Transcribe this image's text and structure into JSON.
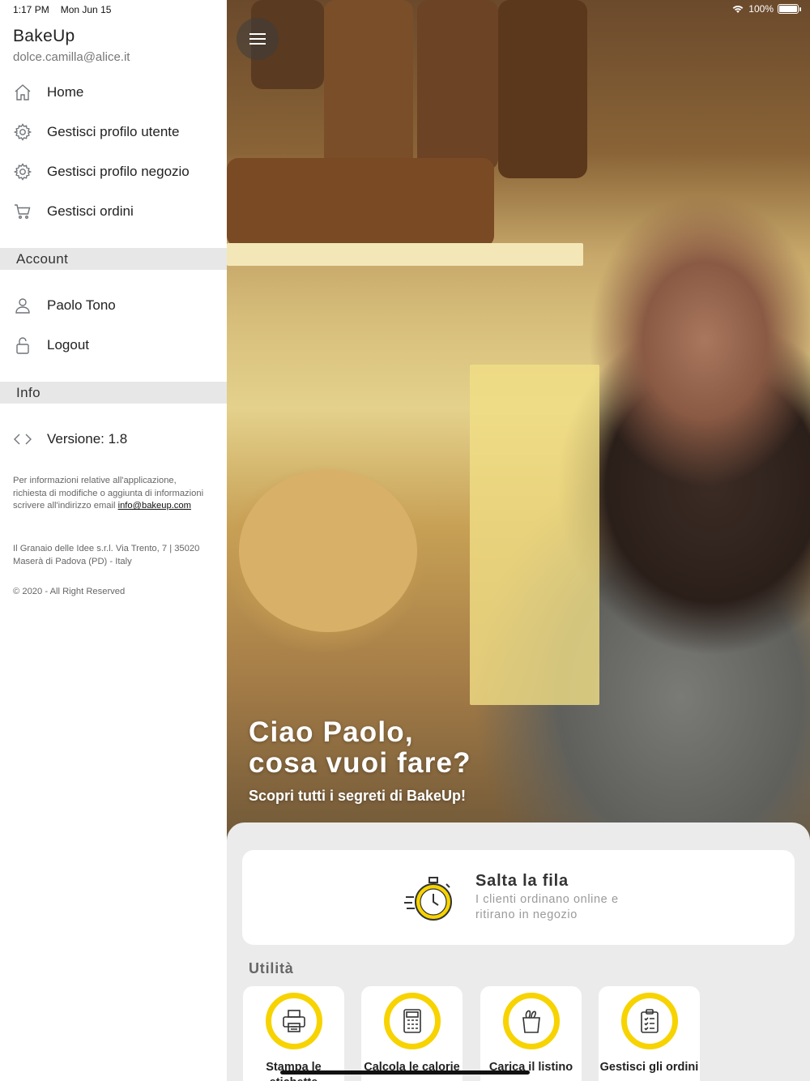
{
  "status_bar": {
    "time": "1:17 PM",
    "date": "Mon Jun 15",
    "battery": "100%",
    "battery_level": 1.0
  },
  "sidebar": {
    "brand": "BakeUp",
    "email": "dolce.camilla@alice.it",
    "menu": [
      {
        "label": "Home",
        "icon": "home-icon"
      },
      {
        "label": "Gestisci profilo utente",
        "icon": "gear-icon"
      },
      {
        "label": "Gestisci profilo negozio",
        "icon": "gear-icon"
      },
      {
        "label": "Gestisci ordini",
        "icon": "cart-icon"
      }
    ],
    "account_header": "Account",
    "account": [
      {
        "label": "Paolo Tono",
        "icon": "user-icon"
      },
      {
        "label": "Logout",
        "icon": "unlock-icon"
      }
    ],
    "info_header": "Info",
    "version": {
      "label": "Versione: 1.8",
      "icon": "code-icon"
    },
    "info_text": "Per informazioni relative all'applicazione, richiesta di modifiche o aggiunta di informazioni scrivere all'indirizzo email",
    "info_email": "info@bakeup.com",
    "address": "Il Granaio delle Idee s.r.l. Via Trento, 7 | 35020 Maserà di Padova (PD) - Italy",
    "copyright": "© 2020 - All Right Reserved"
  },
  "hero": {
    "title_line1": "Ciao Paolo,",
    "title_line2": "cosa vuoi fare?",
    "subtitle": "Scopri tutti i segreti di BakeUp!"
  },
  "main": {
    "salta": {
      "title": "Salta la fila",
      "description": "I clienti ordinano online e ritirano in negozio",
      "icon": "stopwatch-icon"
    },
    "utilita_title": "Utilità",
    "utilities": [
      {
        "label": "Stampa le etichette",
        "icon": "printer-icon"
      },
      {
        "label": "Calcola le calorie",
        "icon": "calculator-icon"
      },
      {
        "label": "Carica il listino",
        "icon": "bread-bag-icon"
      },
      {
        "label": "Gestisci gli ordini",
        "icon": "clipboard-icon"
      }
    ],
    "accent_color": "#f7d300"
  }
}
